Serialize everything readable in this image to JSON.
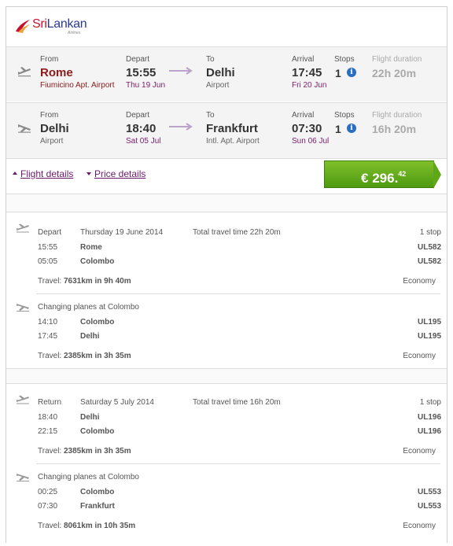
{
  "brand": {
    "name_a": "Sri",
    "name_b": "Lankan",
    "sub": "Airlines"
  },
  "legs": [
    {
      "from_label": "From",
      "from_city": "Rome",
      "from_airport": "Fiumicino Apt. Airport",
      "depart_label": "Depart",
      "depart_time": "15:55",
      "depart_date": "Thu 19 Jun",
      "to_label": "To",
      "to_city": "Delhi",
      "to_airport": "Airport",
      "arrival_label": "Arrival",
      "arrival_time": "17:45",
      "arrival_date": "Fri 20 Jun",
      "stops_label": "Stops",
      "stops": "1",
      "duration_label": "Flight duration",
      "duration": "22h 20m"
    },
    {
      "from_label": "From",
      "from_city": "Delhi",
      "from_airport": "Airport",
      "depart_label": "Depart",
      "depart_time": "18:40",
      "depart_date": "Sat 05 Jul",
      "to_label": "To",
      "to_city": "Frankfurt",
      "to_airport": "Intl. Apt. Airport",
      "arrival_label": "Arrival",
      "arrival_time": "07:30",
      "arrival_date": "Sun 06 Jul",
      "stops_label": "Stops",
      "stops": "1",
      "duration_label": "Flight duration",
      "duration": "16h 20m"
    }
  ],
  "toggles": {
    "flight_details": "Flight details",
    "price_details": "Price details"
  },
  "price": {
    "currency": "€",
    "whole": "296.",
    "cents": "42"
  },
  "outbound": {
    "type": "Depart",
    "date": "Thursday 19 June 2014",
    "total": "Total travel time 22h 20m",
    "stops": "1 stop",
    "seg1": {
      "rows": [
        {
          "time": "15:55",
          "place": "Rome",
          "flight": "UL582"
        },
        {
          "time": "05:05",
          "place": "Colombo",
          "flight": "UL582"
        }
      ],
      "travel_label": "Travel:",
      "travel": "7631km in 9h 40m",
      "cabin": "Economy"
    },
    "change": "Changing planes at Colombo",
    "seg2": {
      "rows": [
        {
          "time": "14:10",
          "place": "Colombo",
          "flight": "UL195"
        },
        {
          "time": "17:45",
          "place": "Delhi",
          "flight": "UL195"
        }
      ],
      "travel_label": "Travel:",
      "travel": "2385km in 3h 35m",
      "cabin": "Economy"
    }
  },
  "inbound": {
    "type": "Return",
    "date": "Saturday 5 July 2014",
    "total": "Total travel time 16h 20m",
    "stops": "1 stop",
    "seg1": {
      "rows": [
        {
          "time": "18:40",
          "place": "Delhi",
          "flight": "UL196"
        },
        {
          "time": "22:15",
          "place": "Colombo",
          "flight": "UL196"
        }
      ],
      "travel_label": "Travel:",
      "travel": "2385km in 3h 35m",
      "cabin": "Economy"
    },
    "change": "Changing planes at Colombo",
    "seg2": {
      "rows": [
        {
          "time": "00:25",
          "place": "Colombo",
          "flight": "UL553"
        },
        {
          "time": "07:30",
          "place": "Frankfurt",
          "flight": "UL553"
        }
      ],
      "travel_label": "Travel:",
      "travel": "8061km in 10h 35m",
      "cabin": "Economy"
    }
  },
  "icons": {
    "takeoff": "plane-takeoff-icon",
    "landing": "plane-landing-icon",
    "info": "info-icon",
    "arrow": "arrow-right-icon"
  },
  "colors": {
    "price_green": "#5ea818",
    "city_red": "#8b1a1a",
    "link_purple": "#6a1a6a",
    "info_blue": "#2a6ec4"
  }
}
